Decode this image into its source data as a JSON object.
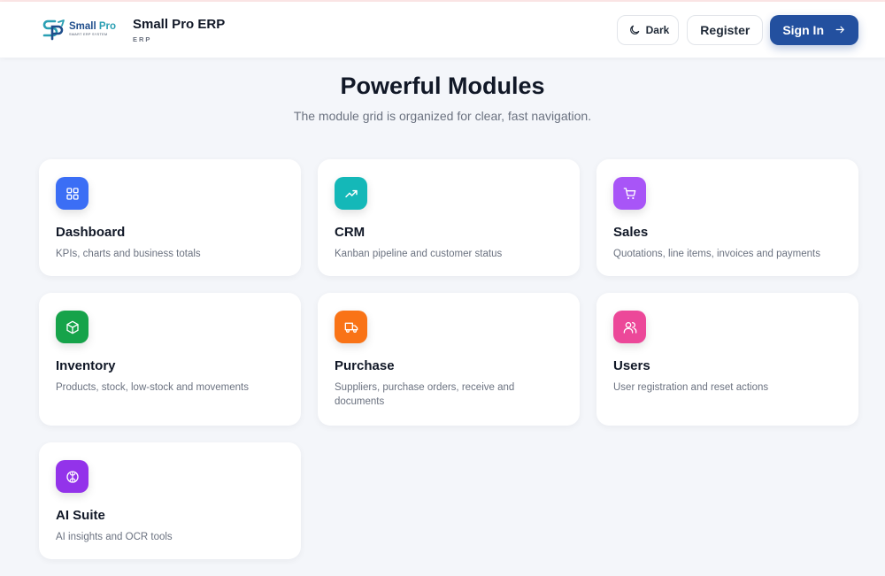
{
  "header": {
    "logo": {
      "main_a": "Small ",
      "main_b": "Pro",
      "tagline": "SMART ERP SYSTEM"
    },
    "brand_name": "Small Pro ERP",
    "brand_sub": "ERP",
    "dark_label": "Dark",
    "register_label": "Register",
    "signin_label": "Sign In"
  },
  "main": {
    "title": "Powerful Modules",
    "subtitle": "The module grid is organized for clear, fast navigation."
  },
  "modules": [
    {
      "title": "Dashboard",
      "desc": "KPIs, charts and business totals",
      "icon": "dashboard-icon",
      "color": "#3b6ef5"
    },
    {
      "title": "CRM",
      "desc": "Kanban pipeline and customer status",
      "icon": "trending-up-icon",
      "color": "#14b8b8"
    },
    {
      "title": "Sales",
      "desc": "Quotations, line items, invoices and payments",
      "icon": "cart-icon",
      "color": "#a855f7"
    },
    {
      "title": "Inventory",
      "desc": "Products, stock, low-stock and movements",
      "icon": "package-icon",
      "color": "#16a34a"
    },
    {
      "title": "Purchase",
      "desc": "Suppliers, purchase orders, receive and documents",
      "icon": "truck-icon",
      "color": "#f97316"
    },
    {
      "title": "Users",
      "desc": "User registration and reset actions",
      "icon": "users-icon",
      "color": "#ec4899"
    },
    {
      "title": "AI Suite",
      "desc": "AI insights and OCR tools",
      "icon": "brain-icon",
      "color": "#9333ea"
    }
  ],
  "colors": {
    "primary": "#23509f",
    "background": "#f4f6fa"
  }
}
